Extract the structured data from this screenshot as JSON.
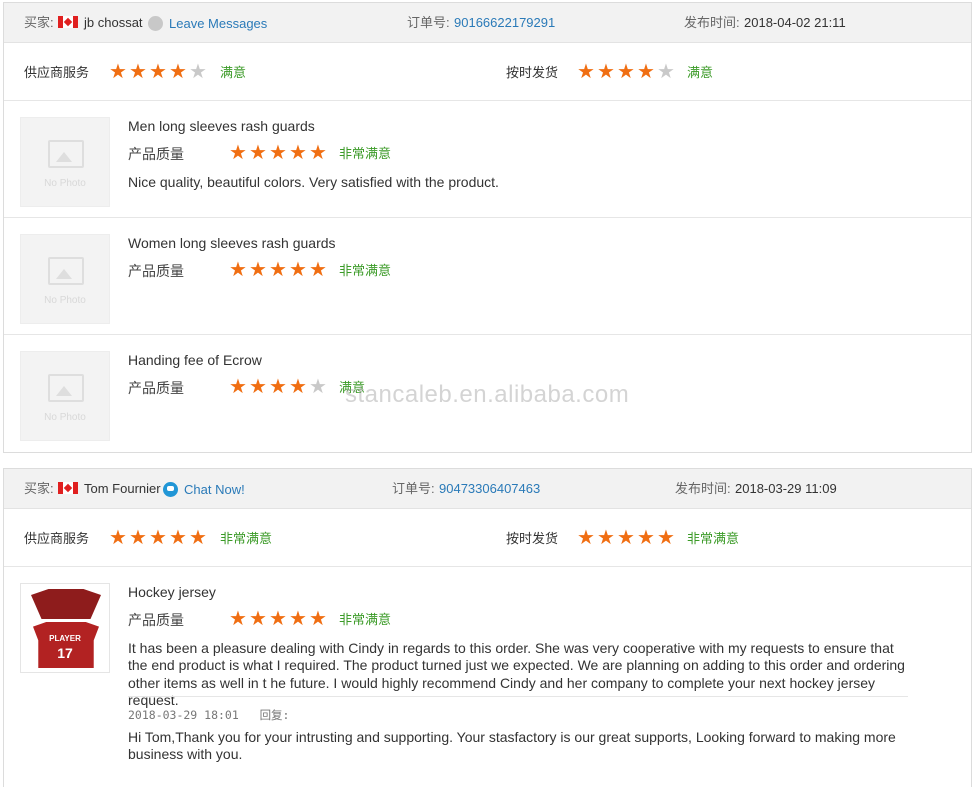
{
  "watermark": "stancaleb.en.alibaba.com",
  "labels": {
    "buyer": "买家:",
    "order_no": "订单号:",
    "published": "发布时间:",
    "supplier_service": "供应商服务",
    "on_time_delivery": "按时发货",
    "product_quality": "产品质量",
    "no_photo": "No Photo"
  },
  "review1": {
    "buyer_name": "jb chossat",
    "buyer_country": "Canada",
    "contact_label": "Leave Messages",
    "order_number": "90166622179291",
    "publish_time": "2018-04-02 21:11",
    "supplier_service": {
      "stars": 4,
      "verdict": "满意"
    },
    "on_time_delivery": {
      "stars": 4,
      "verdict": "满意"
    },
    "items": [
      {
        "name": "Men long sleeves rash guards",
        "stars": 5,
        "verdict": "非常满意",
        "comment": "Nice quality, beautiful colors. Very satisfied with the product."
      },
      {
        "name": "Women long sleeves rash guards",
        "stars": 5,
        "verdict": "非常满意",
        "comment": ""
      },
      {
        "name": "Handing fee of Ecrow",
        "stars": 4,
        "verdict": "满意",
        "comment": ""
      }
    ]
  },
  "review2": {
    "buyer_name": "Tom Fournier",
    "buyer_country": "Canada",
    "contact_label": "Chat Now!",
    "order_number": "90473306407463",
    "publish_time": "2018-03-29 11:09",
    "supplier_service": {
      "stars": 5,
      "verdict": "非常满意"
    },
    "on_time_delivery": {
      "stars": 5,
      "verdict": "非常满意"
    },
    "item": {
      "name": "Hockey jersey",
      "stars": 5,
      "verdict": "非常满意",
      "jersey_text": "PLAYER",
      "jersey_number": "17",
      "comment": "It has been a pleasure dealing with Cindy in regards to this order. She was very cooperative with my requests to ensure that the end product is what I required. The product turned just we expected. We are planning on adding to this order and ordering other items as well in t he future. I would highly recommend Cindy and her company to complete your next hockey jersey request.",
      "reply_time": "2018-03-29 18:01",
      "reply_label": "回复:",
      "reply": "Hi Tom,Thank you for your intrusting and supporting. Your stasfactory is our great supports, Looking forward to making more business with you."
    }
  },
  "colors": {
    "star_on": "#f06e12",
    "star_off": "#c9c9c9",
    "verdict": "#3a9a26",
    "link": "#2a7ab8",
    "header_bg": "#f2f2f2"
  }
}
